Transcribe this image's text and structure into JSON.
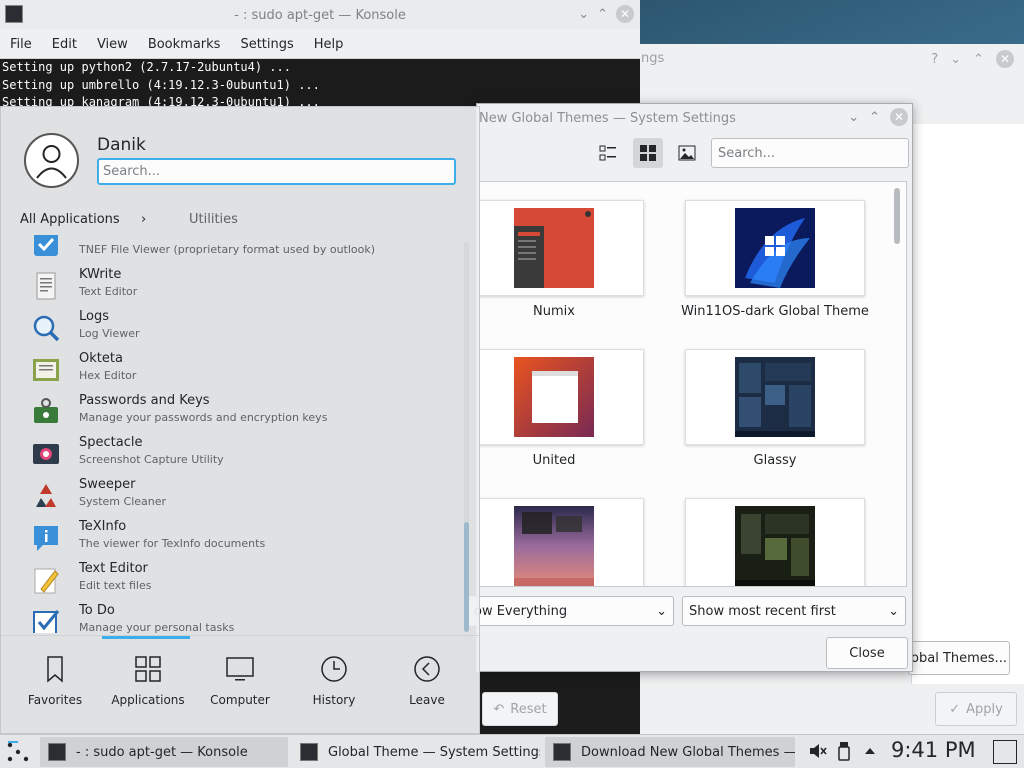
{
  "konsole": {
    "title": "- : sudo apt-get — Konsole",
    "menu": [
      "File",
      "Edit",
      "View",
      "Bookmarks",
      "Settings",
      "Help"
    ],
    "lines": [
      "Setting up python2 (2.7.17-2ubuntu4) ...",
      "Setting up umbrello (4:19.12.3-0ubuntu1) ...",
      "Setting up kanagram (4:19.12.3-0ubuntu1) ..."
    ]
  },
  "back_window": {
    "title_fragment": "ngs",
    "get_new_label": "obal Themes...",
    "apply_label": "Apply",
    "reset_label": "Reset"
  },
  "dialog": {
    "title": "New Global Themes — System Settings",
    "search_placeholder": "Search...",
    "themes": [
      {
        "name": "Numix"
      },
      {
        "name": "Win11OS-dark Global Theme"
      },
      {
        "name": "United"
      },
      {
        "name": "Glassy"
      },
      {
        "name": ""
      },
      {
        "name": ""
      }
    ],
    "filter_value": "ow Everything",
    "sort_value": "Show most recent first",
    "close_label": "Close"
  },
  "launcher": {
    "user": "Danik",
    "search_placeholder": "Search...",
    "breadcrumb_root": "All Applications",
    "breadcrumb_current": "Utilities",
    "apps": [
      {
        "name": "",
        "desc": "TNEF File Viewer (proprietary format used by outlook)",
        "icon": "tnef-icon"
      },
      {
        "name": "KWrite",
        "desc": "Text Editor",
        "icon": "kwrite-icon"
      },
      {
        "name": "Logs",
        "desc": "Log Viewer",
        "icon": "logs-icon"
      },
      {
        "name": "Okteta",
        "desc": "Hex Editor",
        "icon": "okteta-icon"
      },
      {
        "name": "Passwords and Keys",
        "desc": "Manage your passwords and encryption keys",
        "icon": "passwords-icon"
      },
      {
        "name": "Spectacle",
        "desc": "Screenshot Capture Utility",
        "icon": "spectacle-icon"
      },
      {
        "name": "Sweeper",
        "desc": "System Cleaner",
        "icon": "sweeper-icon"
      },
      {
        "name": "TeXInfo",
        "desc": "The viewer for TexInfo documents",
        "icon": "texinfo-icon"
      },
      {
        "name": "Text Editor",
        "desc": "Edit text files",
        "icon": "text-editor-icon"
      },
      {
        "name": "To Do",
        "desc": "Manage your personal tasks",
        "icon": "todo-icon"
      }
    ],
    "tabs": [
      "Favorites",
      "Applications",
      "Computer",
      "History",
      "Leave"
    ]
  },
  "taskbar": {
    "tasks": [
      "- : sudo apt-get — Konsole",
      "Global Theme — System Settings",
      "Download New Global Themes —..."
    ],
    "clock": "9:41 PM"
  },
  "colors": {
    "accent": "#3daee9",
    "window_bg": "#eff0f1",
    "terminal_bg": "#1b1b1b"
  }
}
